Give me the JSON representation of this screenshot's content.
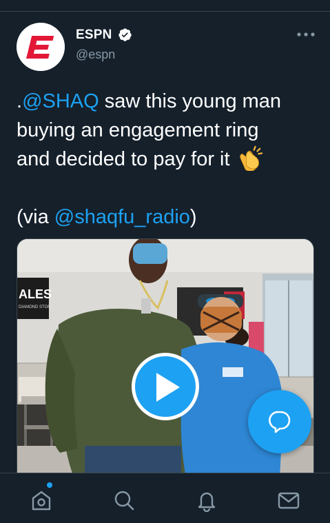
{
  "author": {
    "name": "ESPN",
    "handle": "@espn",
    "verified": true,
    "avatar_icon": "espn-logo-icon",
    "brand_color": "#e31837"
  },
  "tweet": {
    "lead": ".",
    "mention_1": "@SHAQ",
    "line_1_rest": " saw this young man",
    "line_2": "buying an engagement ring",
    "line_3": "and decided to pay for it",
    "emoji": "clapping-hands-emoji",
    "via_open": "(via ",
    "mention_2": "@shaqfu_radio",
    "via_close": ")"
  },
  "media": {
    "type": "video",
    "store_sign": "ALES",
    "store_sign_sub": "DIAMOND STORE"
  },
  "colors": {
    "background": "#15202b",
    "accent": "#1da1f2",
    "text_secondary": "#8899a6",
    "divider": "#38444d"
  },
  "nav": {
    "items": [
      "home-icon",
      "search-icon",
      "notifications-icon",
      "messages-icon"
    ],
    "home_has_new": true
  }
}
